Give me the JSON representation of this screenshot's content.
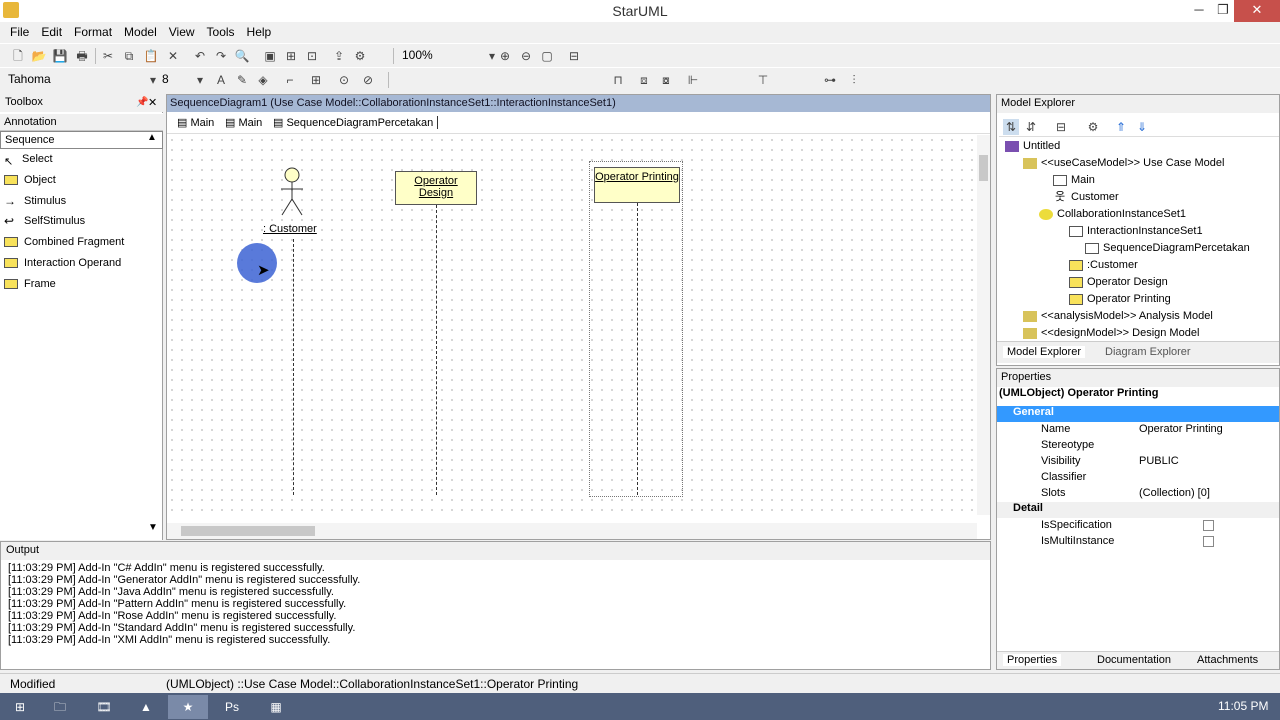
{
  "window": {
    "title": "StarUML",
    "minimize": "─",
    "maximize": "❐",
    "close": "✕"
  },
  "menu": [
    "File",
    "Edit",
    "Format",
    "Model",
    "View",
    "Tools",
    "Help"
  ],
  "toolbar1": {
    "zoom": "100%"
  },
  "toolbar2": {
    "font": "Tahoma",
    "size": "8"
  },
  "toolbox": {
    "title": "Toolbox",
    "category1": "Annotation",
    "category2": "Sequence",
    "items": [
      "Select",
      "Object",
      "Stimulus",
      "SelfStimulus",
      "Combined Fragment",
      "Interaction Operand",
      "Frame"
    ]
  },
  "diagram": {
    "title": "SequenceDiagram1 (Use Case Model::CollaborationInstanceSet1::InteractionInstanceSet1)",
    "tabs": [
      "Main",
      "Main",
      "SequenceDiagramPercetakan"
    ],
    "objects": {
      "customer": ": Customer",
      "design": "Operator Design",
      "printing": "Operator Printing"
    }
  },
  "explorer": {
    "title": "Model Explorer",
    "tree": [
      "Untitled",
      "<<useCaseModel>> Use Case Model",
      "Main",
      "Customer",
      "CollaborationInstanceSet1",
      "InteractionInstanceSet1",
      "SequenceDiagramPercetakan",
      ":Customer",
      "Operator Design",
      "Operator Printing",
      "<<analysisModel>> Analysis Model",
      "<<designModel>> Design Model"
    ],
    "tabs": [
      "Model Explorer",
      "Diagram Explorer"
    ]
  },
  "properties": {
    "title": "Properties",
    "header": "(UMLObject) Operator Printing",
    "general": "General",
    "detail": "Detail",
    "rows": [
      {
        "k": "Name",
        "v": "Operator Printing"
      },
      {
        "k": "Stereotype",
        "v": ""
      },
      {
        "k": "Visibility",
        "v": "PUBLIC"
      },
      {
        "k": "Classifier",
        "v": ""
      },
      {
        "k": "Slots",
        "v": "(Collection) [0]"
      }
    ],
    "detailRows": [
      {
        "k": "IsSpecification"
      },
      {
        "k": "IsMultiInstance"
      }
    ],
    "tabs": [
      "Properties",
      "Documentation",
      "Attachments"
    ]
  },
  "output": {
    "title": "Output",
    "lines": [
      "[11:03:29 PM]  Add-In \"C# AddIn\" menu is registered successfully.",
      "[11:03:29 PM]  Add-In \"Generator AddIn\" menu is registered successfully.",
      "[11:03:29 PM]  Add-In \"Java AddIn\" menu is registered successfully.",
      "[11:03:29 PM]  Add-In \"Pattern AddIn\" menu is registered successfully.",
      "[11:03:29 PM]  Add-In \"Rose AddIn\" menu is registered successfully.",
      "[11:03:29 PM]  Add-In \"Standard AddIn\" menu is registered successfully.",
      "[11:03:29 PM]  Add-In \"XMI AddIn\" menu is registered successfully."
    ]
  },
  "status": {
    "state": "Modified",
    "path": "(UMLObject) ::Use Case Model::CollaborationInstanceSet1::Operator Printing"
  },
  "taskbar": {
    "time": "11:05 PM"
  }
}
